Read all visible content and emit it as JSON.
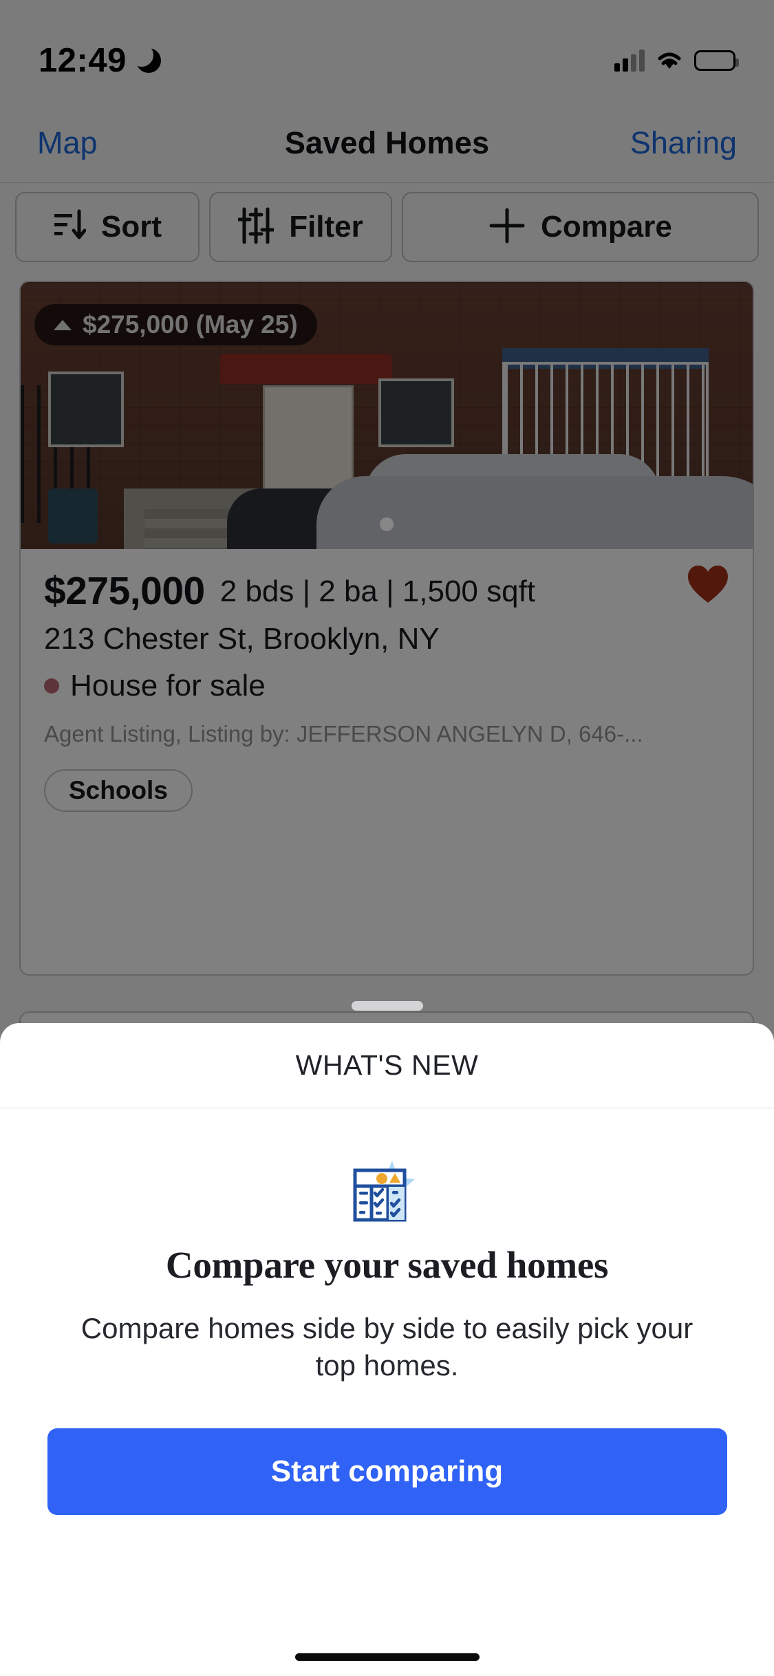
{
  "status_bar": {
    "time": "12:49",
    "moon_icon": "crescent-moon-icon",
    "cellular_icon": "cellular-bars-icon",
    "wifi_icon": "wifi-icon",
    "battery_icon": "battery-full-icon"
  },
  "nav_bar": {
    "left_label": "Map",
    "title": "Saved Homes",
    "right_label": "Sharing",
    "link_color": "#1e63d0"
  },
  "toolbar": {
    "sort_label": "Sort",
    "sort_icon": "sort-descending-icon",
    "filter_label": "Filter",
    "filter_icon": "sliders-icon",
    "compare_label": "Compare",
    "compare_icon": "plus-icon"
  },
  "property_card": {
    "price_badge": {
      "direction_icon": "arrow-up-icon",
      "text": "$275,000 (May 25)"
    },
    "price": "$275,000",
    "facts": "2 bds | 2 ba | 1,500 sqft",
    "address": "213 Chester St, Brooklyn, NY",
    "status": "House for sale",
    "status_dot_color": "#b0626a",
    "agent": "Agent Listing, Listing by: JEFFERSON ANGELYN D, 646-...",
    "schools_chip": "Schools",
    "favorite_icon": "heart-filled-icon",
    "favorite_color": "#9c2f18"
  },
  "bottom_sheet": {
    "header_title": "WHAT'S NEW",
    "illustration_icon": "compare-table-icon",
    "heading": "Compare your saved homes",
    "body": "Compare homes side by side to easily pick your top homes.",
    "cta_label": "Start comparing",
    "cta_color": "#2f62f5"
  }
}
